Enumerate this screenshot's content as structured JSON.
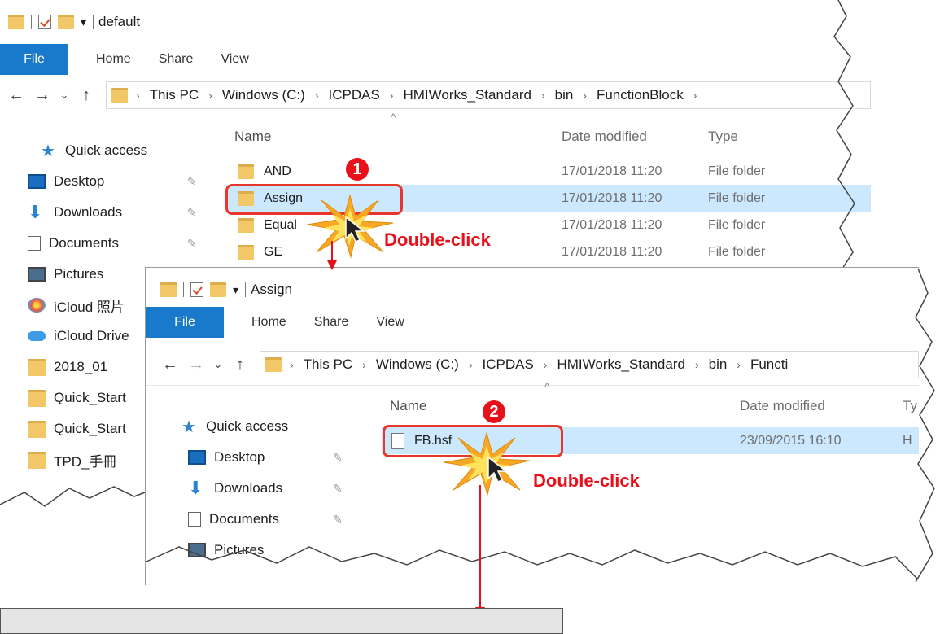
{
  "window1": {
    "title": "default",
    "ribbon": {
      "file": "File",
      "tabs": [
        "Home",
        "Share",
        "View"
      ]
    },
    "breadcrumb": [
      "This PC",
      "Windows (C:)",
      "ICPDAS",
      "HMIWorks_Standard",
      "bin",
      "FunctionBlock"
    ],
    "nav": {
      "quick_access": "Quick access",
      "items": [
        "Desktop",
        "Downloads",
        "Documents",
        "Pictures",
        "iCloud 照片",
        "iCloud Drive",
        "2018_01",
        "Quick_Start",
        "Quick_Start",
        "TPD_手冊"
      ]
    },
    "columns": {
      "name": "Name",
      "date": "Date modified",
      "type": "Type"
    },
    "rows": [
      {
        "name": "AND",
        "date": "17/01/2018 11:20",
        "type": "File folder"
      },
      {
        "name": "Assign",
        "date": "17/01/2018 11:20",
        "type": "File folder"
      },
      {
        "name": "Equal",
        "date": "17/01/2018 11:20",
        "type": "File folder"
      },
      {
        "name": "GE",
        "date": "17/01/2018 11:20",
        "type": "File folder"
      }
    ]
  },
  "window2": {
    "title": "Assign",
    "ribbon": {
      "file": "File",
      "tabs": [
        "Home",
        "Share",
        "View"
      ]
    },
    "breadcrumb": [
      "This PC",
      "Windows (C:)",
      "ICPDAS",
      "HMIWorks_Standard",
      "bin",
      "Functi"
    ],
    "nav": {
      "quick_access": "Quick access",
      "items": [
        "Desktop",
        "Downloads",
        "Documents",
        "Pictures"
      ]
    },
    "columns": {
      "name": "Name",
      "date": "Date modified",
      "type": "Ty"
    },
    "rows": [
      {
        "name": "FB.hsf",
        "date": "23/09/2015 16:10",
        "type": "H"
      }
    ]
  },
  "annotations": {
    "step1": "1",
    "step2": "2",
    "action1": "Double-click",
    "action2": "Double-click"
  },
  "colors": {
    "accent": "#1979ca",
    "selection": "#cce8ff",
    "callout": "#e8372a",
    "annotation_text": "#e8101a",
    "folder": "#f2c768"
  }
}
